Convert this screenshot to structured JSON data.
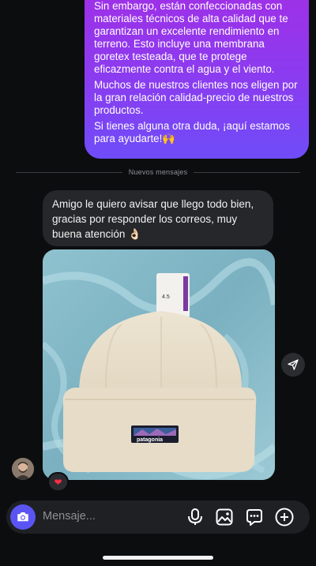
{
  "conversation": {
    "outgoing_message": {
      "paragraphs": [
        "Sin embargo, están confeccionadas con materiales técnicos de alta calidad que te garantizan un excelente rendimiento en terreno. Esto incluye una membrana goretex testeada, que te protege eficazmente contra el agua y el viento.",
        "Muchos de nuestros clientes nos eligen por la gran relación calidad-precio de nuestros productos.",
        "Si tienes alguna otra duda, ¡aquí estamos para ayudarte!🙌"
      ]
    },
    "divider_label": "Nuevos mensajes",
    "incoming_message": {
      "text": "Amigo le quiero avisar que llego todo bien, gracias por responder los correos, muy buena atención 👌🏻"
    },
    "photo": {
      "tag_text": "4.5",
      "label_text": "patagonia"
    },
    "reaction": "❤"
  },
  "composer": {
    "placeholder": "Mensaje..."
  },
  "icons": {
    "camera": "camera-icon",
    "share": "send-icon",
    "microphone": "microphone-icon",
    "gallery": "gallery-icon",
    "sticker": "sticker-icon",
    "add": "plus-icon"
  },
  "colors": {
    "accent": "#5a55f2",
    "outgoing_bubble": "#8a3cf0",
    "incoming_bubble": "#26272a",
    "background": "#0c0d0f"
  }
}
